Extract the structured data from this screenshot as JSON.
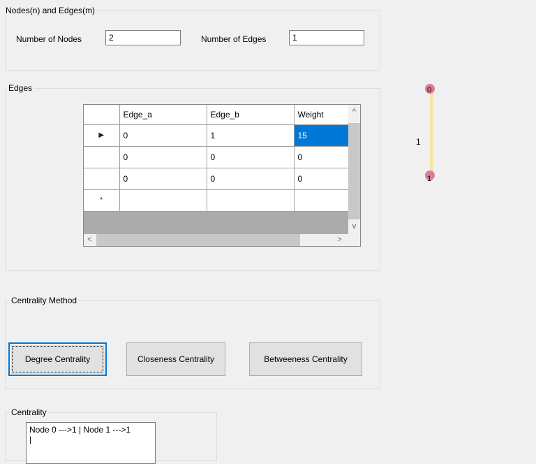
{
  "nodes_edges_group": {
    "title": "Nodes(n) and Edges(m)",
    "nodes_label": "Number of Nodes",
    "nodes_value": "2",
    "edges_label": "Number of Edges",
    "edges_value": "1"
  },
  "edges_group": {
    "title": "Edges",
    "columns": [
      "Edge_a",
      "Edge_b",
      "Weight"
    ],
    "rows": [
      {
        "marker": "▶",
        "a": "0",
        "b": "1",
        "w": "15"
      },
      {
        "marker": "",
        "a": "0",
        "b": "0",
        "w": "0"
      },
      {
        "marker": "",
        "a": "0",
        "b": "0",
        "w": "0"
      },
      {
        "marker": "*",
        "a": "",
        "b": "",
        "w": ""
      }
    ],
    "scroll_up": "^",
    "scroll_down": "v",
    "scroll_left": "<",
    "scroll_right": ">"
  },
  "graph": {
    "node_top": "0",
    "node_bottom": "1",
    "edge_weight": "1",
    "edge_color": "#f3e6a6",
    "node_color": "#d9668b"
  },
  "centrality_method_group": {
    "title": "Centrality Method",
    "degree_button": "Degree Centrality",
    "closeness_button": "Closeness Centrality",
    "betweeness_button": "Betweeness Centrality"
  },
  "centrality_group": {
    "title": "Centrality",
    "output_text": "Node 0 --->1 | Node 1 --->1\n|"
  }
}
